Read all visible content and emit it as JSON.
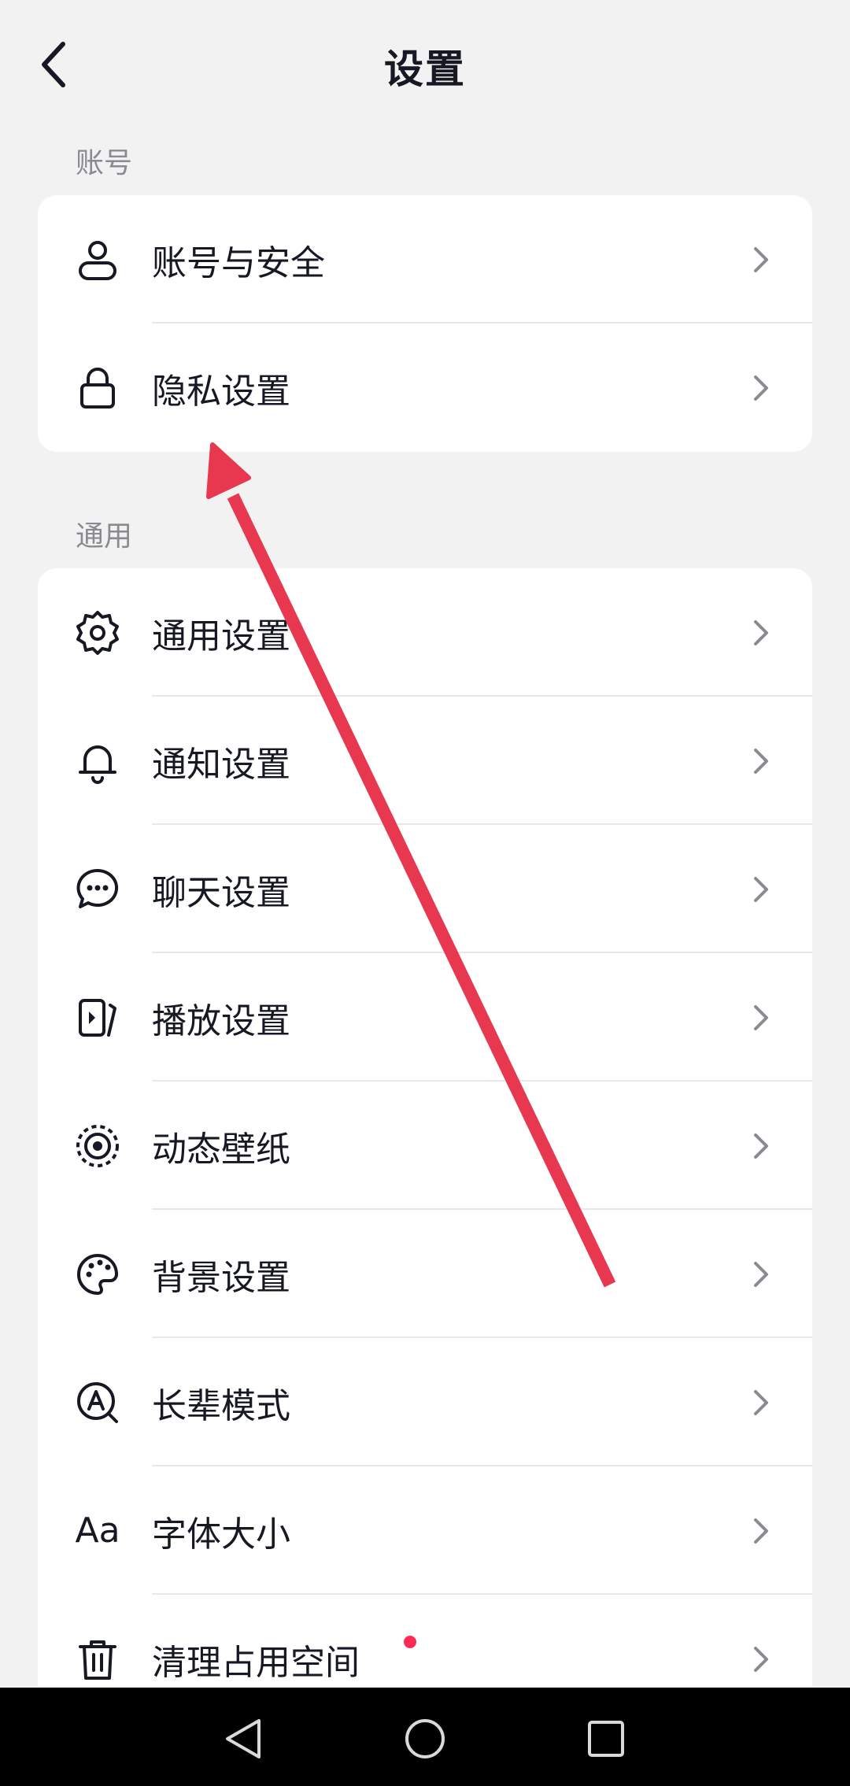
{
  "header": {
    "title": "设置"
  },
  "sections": [
    {
      "label": "账号"
    },
    {
      "label": "通用"
    }
  ],
  "account_items": [
    {
      "label": "账号与安全",
      "icon": "user-icon"
    },
    {
      "label": "隐私设置",
      "icon": "lock-icon"
    }
  ],
  "general_items": [
    {
      "label": "通用设置",
      "icon": "gear-icon"
    },
    {
      "label": "通知设置",
      "icon": "bell-icon"
    },
    {
      "label": "聊天设置",
      "icon": "chat-bubble-icon"
    },
    {
      "label": "播放设置",
      "icon": "play-settings-icon"
    },
    {
      "label": "动态壁纸",
      "icon": "dynamic-wallpaper-icon"
    },
    {
      "label": "背景设置",
      "icon": "palette-icon"
    },
    {
      "label": "长辈模式",
      "icon": "elder-mode-icon"
    },
    {
      "label": "字体大小",
      "icon": "font-size-icon",
      "icon_text": "Aa"
    },
    {
      "label": "清理占用空间",
      "icon": "trash-icon",
      "badge": "red-dot"
    }
  ],
  "colors": {
    "background": "#f2f2f2",
    "card": "#ffffff",
    "text": "#161823",
    "section_label": "#8a8b91",
    "badge": "#fe2c55",
    "annotation_arrow": "#e8384f",
    "nav_bar": "#000000"
  },
  "system_nav": [
    {
      "icon": "back-triangle-icon"
    },
    {
      "icon": "home-circle-icon"
    },
    {
      "icon": "recents-square-icon"
    }
  ]
}
